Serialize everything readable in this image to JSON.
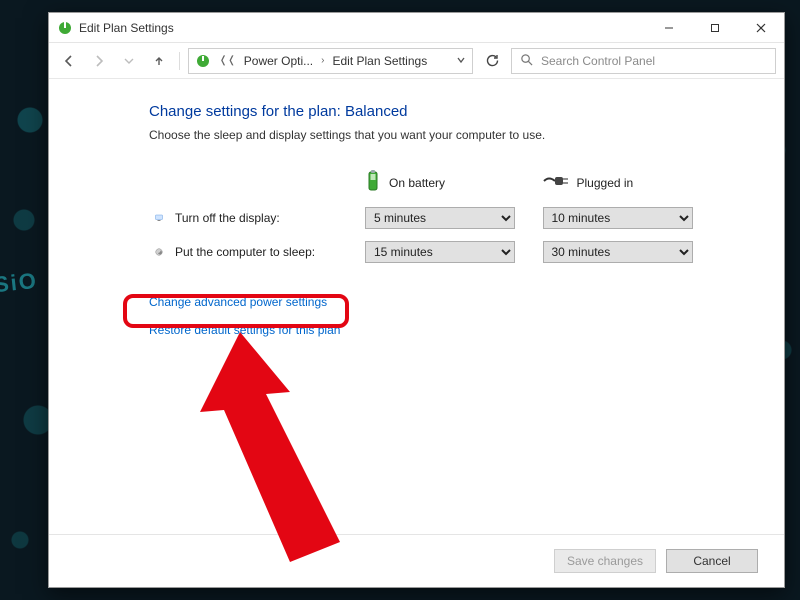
{
  "window": {
    "title": "Edit Plan Settings",
    "minimize_tooltip": "Minimize",
    "maximize_tooltip": "Maximize",
    "close_tooltip": "Close"
  },
  "nav": {
    "back_tooltip": "Back",
    "forward_tooltip": "Forward",
    "up_tooltip": "Up",
    "refresh_tooltip": "Refresh",
    "breadcrumb": {
      "seg1": "Power Opti...",
      "seg2": "Edit Plan Settings"
    },
    "search_placeholder": "Search Control Panel"
  },
  "page": {
    "heading": "Change settings for the plan: Balanced",
    "subtext": "Choose the sleep and display settings that you want your computer to use.",
    "col_battery": "On battery",
    "col_plugged": "Plugged in",
    "row_display_label": "Turn off the display:",
    "row_sleep_label": "Put the computer to sleep:",
    "display_battery_value": "5 minutes",
    "display_plugged_value": "10 minutes",
    "sleep_battery_value": "15 minutes",
    "sleep_plugged_value": "30 minutes",
    "link_advanced": "Change advanced power settings",
    "link_restore": "Restore default settings for this plan"
  },
  "footer": {
    "save": "Save changes",
    "cancel": "Cancel"
  }
}
